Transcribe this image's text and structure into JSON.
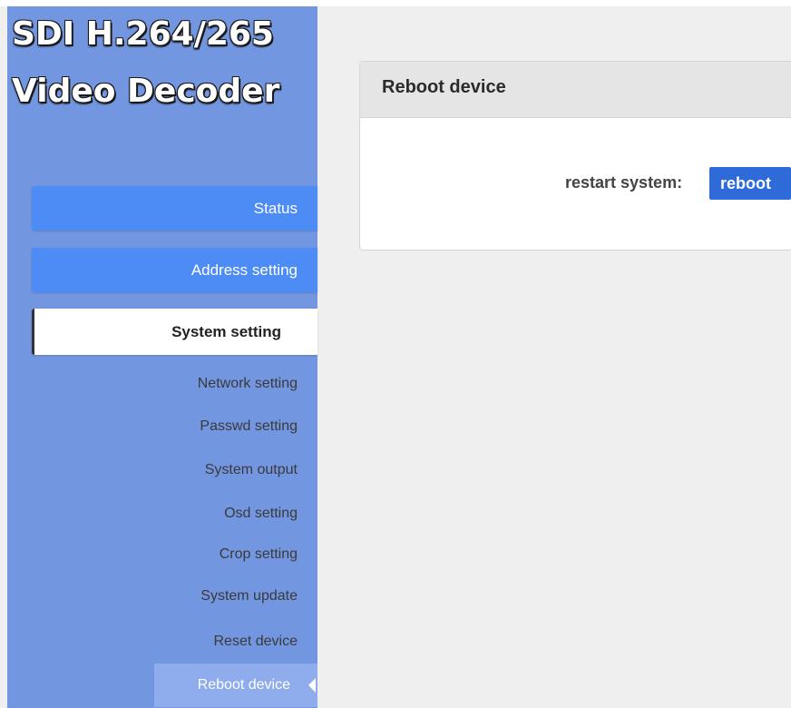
{
  "brand": {
    "line1": "SDI H.264/265",
    "line2": "Video Decoder"
  },
  "nav": {
    "status": "Status",
    "address": "Address setting",
    "system": "System setting",
    "sub_items": {
      "network": "Network setting",
      "passwd": "Passwd setting",
      "output": "System output",
      "osd": "Osd setting",
      "crop": "Crop setting",
      "update": "System update",
      "reset": "Reset device",
      "reboot": "Reboot device"
    }
  },
  "panel": {
    "title": "Reboot device",
    "label": "restart system:",
    "button": "reboot"
  },
  "colors": {
    "sidebar_bg": "#7396e0",
    "nav_button": "#4d8bf5",
    "active_sub_bg": "#8facec",
    "reboot_button": "#2e6ad8",
    "page_bg": "#efefef"
  }
}
